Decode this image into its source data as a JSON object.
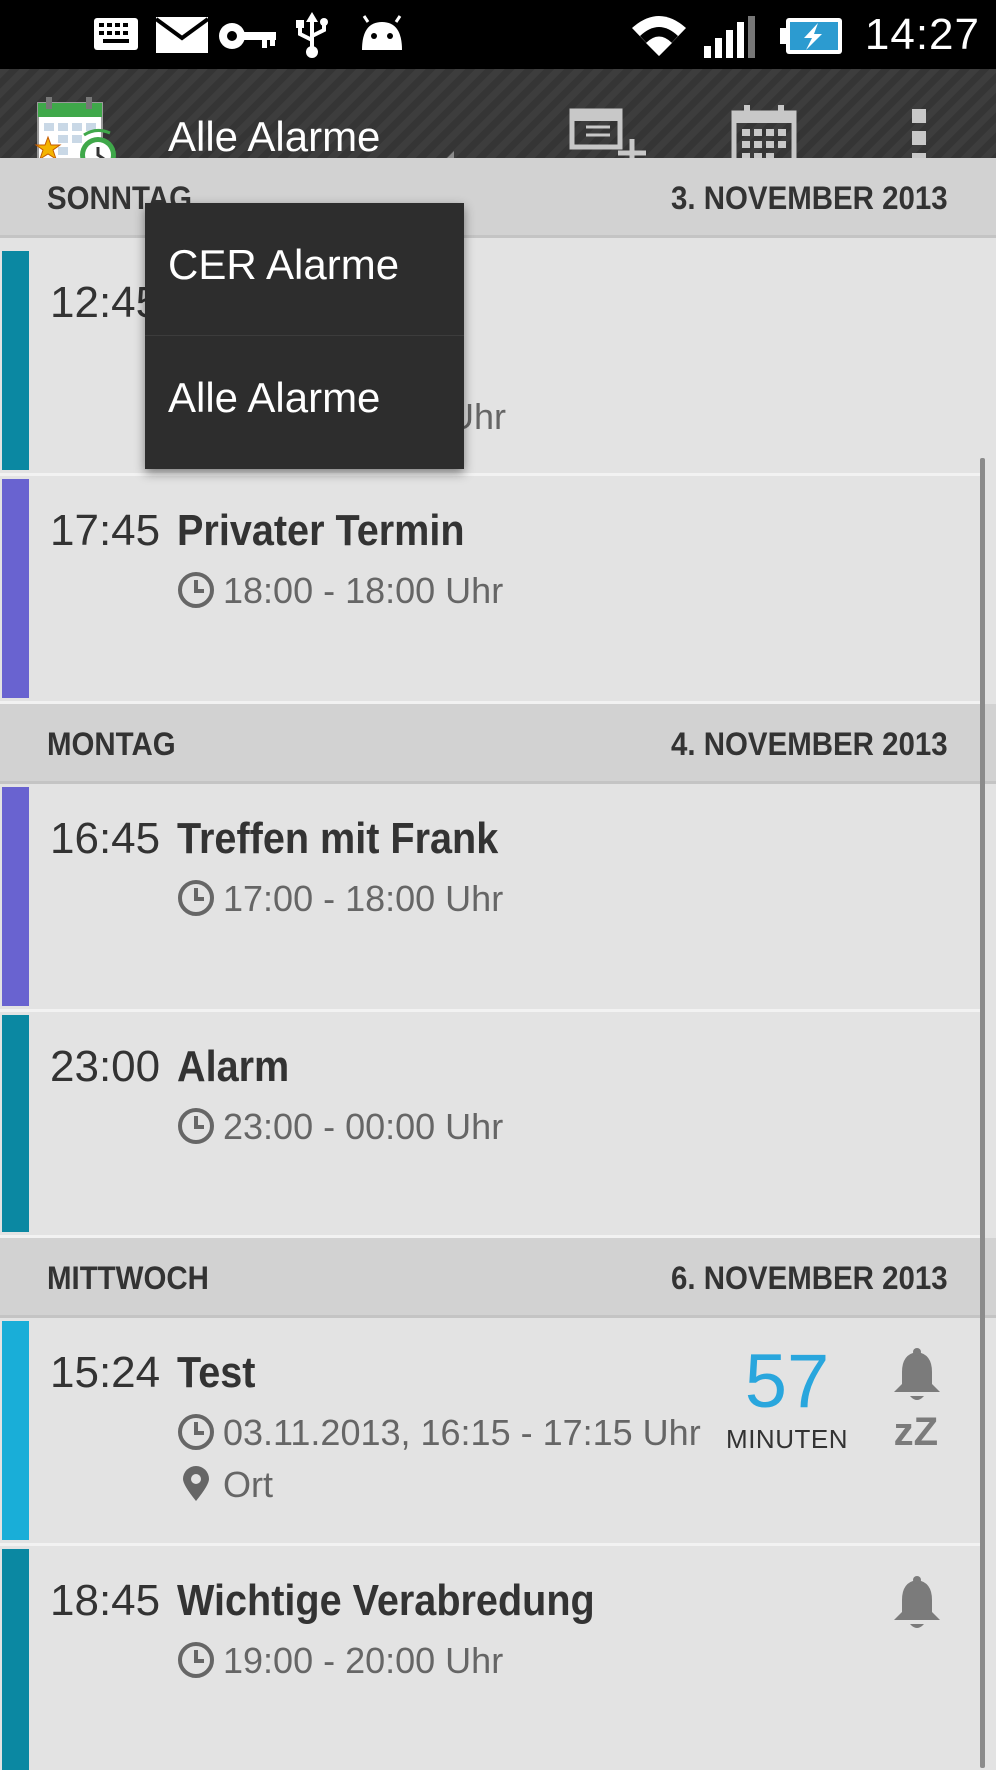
{
  "status_bar": {
    "time": "14:27",
    "icons": [
      "keyboard-icon",
      "mail-icon",
      "key-icon",
      "usb-icon",
      "android-icon",
      "wifi-icon",
      "signal-icon",
      "battery-charging-icon"
    ]
  },
  "action_bar": {
    "spinner_label": "Alle Alarme",
    "actions": [
      "add-event-icon",
      "calendar-icon",
      "overflow-menu-icon"
    ]
  },
  "dropdown": {
    "options": [
      "CER Alarme",
      "Alle Alarme"
    ]
  },
  "sections": [
    {
      "day": "SONNTAG",
      "date": "3. NOVEMBER 2013",
      "events": [
        {
          "time": "12:45",
          "title": "",
          "range": "Uhr",
          "color": "#0b88a2"
        },
        {
          "time": "17:45",
          "title": "Privater Termin",
          "range": "18:00 - 18:00 Uhr",
          "color": "#6963d0"
        }
      ]
    },
    {
      "day": "MONTAG",
      "date": "4. NOVEMBER 2013",
      "events": [
        {
          "time": "16:45",
          "title": "Treffen mit Frank",
          "range": "17:00 - 18:00 Uhr",
          "color": "#6963d0"
        },
        {
          "time": "23:00",
          "title": "Alarm",
          "range": "23:00 - 00:00 Uhr",
          "color": "#0b88a2"
        }
      ]
    },
    {
      "day": "MITTWOCH",
      "date": "6. NOVEMBER 2013",
      "events": [
        {
          "time": "15:24",
          "title": "Test",
          "range": "03.11.2013, 16:15 - 17:15 Uhr",
          "location": "Ort",
          "countdown": "57",
          "countdown_unit": "MINUTEN",
          "snooze": "zZ",
          "color": "#19aed8"
        },
        {
          "time": "18:45",
          "title": "Wichtige Verabredung",
          "range": "19:00 - 20:00 Uhr",
          "color": "#0b88a2"
        }
      ]
    }
  ]
}
